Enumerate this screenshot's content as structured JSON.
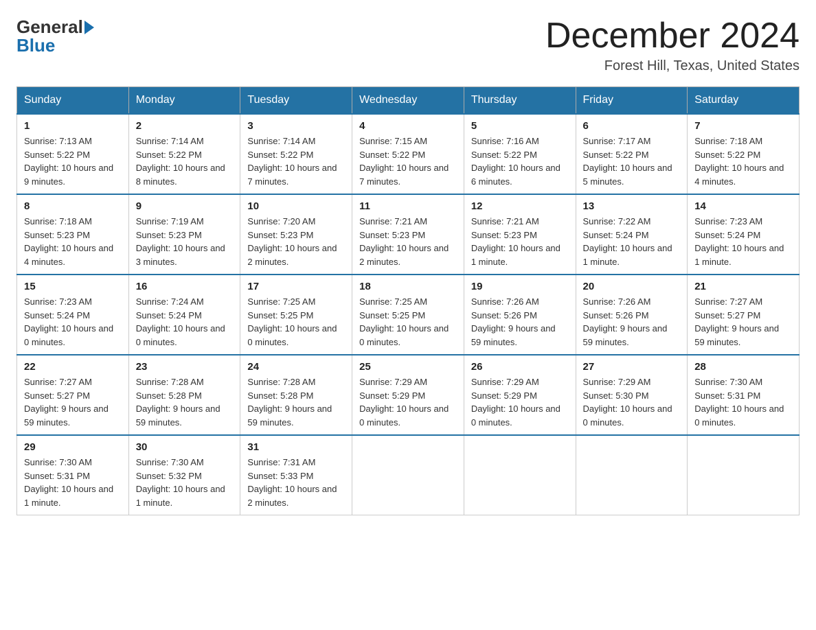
{
  "header": {
    "logo_text_general": "General",
    "logo_text_blue": "Blue",
    "month_title": "December 2024",
    "location": "Forest Hill, Texas, United States"
  },
  "days_of_week": [
    "Sunday",
    "Monday",
    "Tuesday",
    "Wednesday",
    "Thursday",
    "Friday",
    "Saturday"
  ],
  "weeks": [
    [
      {
        "day": "1",
        "sunrise": "7:13 AM",
        "sunset": "5:22 PM",
        "daylight": "10 hours and 9 minutes."
      },
      {
        "day": "2",
        "sunrise": "7:14 AM",
        "sunset": "5:22 PM",
        "daylight": "10 hours and 8 minutes."
      },
      {
        "day": "3",
        "sunrise": "7:14 AM",
        "sunset": "5:22 PM",
        "daylight": "10 hours and 7 minutes."
      },
      {
        "day": "4",
        "sunrise": "7:15 AM",
        "sunset": "5:22 PM",
        "daylight": "10 hours and 7 minutes."
      },
      {
        "day": "5",
        "sunrise": "7:16 AM",
        "sunset": "5:22 PM",
        "daylight": "10 hours and 6 minutes."
      },
      {
        "day": "6",
        "sunrise": "7:17 AM",
        "sunset": "5:22 PM",
        "daylight": "10 hours and 5 minutes."
      },
      {
        "day": "7",
        "sunrise": "7:18 AM",
        "sunset": "5:22 PM",
        "daylight": "10 hours and 4 minutes."
      }
    ],
    [
      {
        "day": "8",
        "sunrise": "7:18 AM",
        "sunset": "5:23 PM",
        "daylight": "10 hours and 4 minutes."
      },
      {
        "day": "9",
        "sunrise": "7:19 AM",
        "sunset": "5:23 PM",
        "daylight": "10 hours and 3 minutes."
      },
      {
        "day": "10",
        "sunrise": "7:20 AM",
        "sunset": "5:23 PM",
        "daylight": "10 hours and 2 minutes."
      },
      {
        "day": "11",
        "sunrise": "7:21 AM",
        "sunset": "5:23 PM",
        "daylight": "10 hours and 2 minutes."
      },
      {
        "day": "12",
        "sunrise": "7:21 AM",
        "sunset": "5:23 PM",
        "daylight": "10 hours and 1 minute."
      },
      {
        "day": "13",
        "sunrise": "7:22 AM",
        "sunset": "5:24 PM",
        "daylight": "10 hours and 1 minute."
      },
      {
        "day": "14",
        "sunrise": "7:23 AM",
        "sunset": "5:24 PM",
        "daylight": "10 hours and 1 minute."
      }
    ],
    [
      {
        "day": "15",
        "sunrise": "7:23 AM",
        "sunset": "5:24 PM",
        "daylight": "10 hours and 0 minutes."
      },
      {
        "day": "16",
        "sunrise": "7:24 AM",
        "sunset": "5:24 PM",
        "daylight": "10 hours and 0 minutes."
      },
      {
        "day": "17",
        "sunrise": "7:25 AM",
        "sunset": "5:25 PM",
        "daylight": "10 hours and 0 minutes."
      },
      {
        "day": "18",
        "sunrise": "7:25 AM",
        "sunset": "5:25 PM",
        "daylight": "10 hours and 0 minutes."
      },
      {
        "day": "19",
        "sunrise": "7:26 AM",
        "sunset": "5:26 PM",
        "daylight": "9 hours and 59 minutes."
      },
      {
        "day": "20",
        "sunrise": "7:26 AM",
        "sunset": "5:26 PM",
        "daylight": "9 hours and 59 minutes."
      },
      {
        "day": "21",
        "sunrise": "7:27 AM",
        "sunset": "5:27 PM",
        "daylight": "9 hours and 59 minutes."
      }
    ],
    [
      {
        "day": "22",
        "sunrise": "7:27 AM",
        "sunset": "5:27 PM",
        "daylight": "9 hours and 59 minutes."
      },
      {
        "day": "23",
        "sunrise": "7:28 AM",
        "sunset": "5:28 PM",
        "daylight": "9 hours and 59 minutes."
      },
      {
        "day": "24",
        "sunrise": "7:28 AM",
        "sunset": "5:28 PM",
        "daylight": "9 hours and 59 minutes."
      },
      {
        "day": "25",
        "sunrise": "7:29 AM",
        "sunset": "5:29 PM",
        "daylight": "10 hours and 0 minutes."
      },
      {
        "day": "26",
        "sunrise": "7:29 AM",
        "sunset": "5:29 PM",
        "daylight": "10 hours and 0 minutes."
      },
      {
        "day": "27",
        "sunrise": "7:29 AM",
        "sunset": "5:30 PM",
        "daylight": "10 hours and 0 minutes."
      },
      {
        "day": "28",
        "sunrise": "7:30 AM",
        "sunset": "5:31 PM",
        "daylight": "10 hours and 0 minutes."
      }
    ],
    [
      {
        "day": "29",
        "sunrise": "7:30 AM",
        "sunset": "5:31 PM",
        "daylight": "10 hours and 1 minute."
      },
      {
        "day": "30",
        "sunrise": "7:30 AM",
        "sunset": "5:32 PM",
        "daylight": "10 hours and 1 minute."
      },
      {
        "day": "31",
        "sunrise": "7:31 AM",
        "sunset": "5:33 PM",
        "daylight": "10 hours and 2 minutes."
      },
      null,
      null,
      null,
      null
    ]
  ],
  "labels": {
    "sunrise": "Sunrise:",
    "sunset": "Sunset:",
    "daylight": "Daylight:"
  }
}
